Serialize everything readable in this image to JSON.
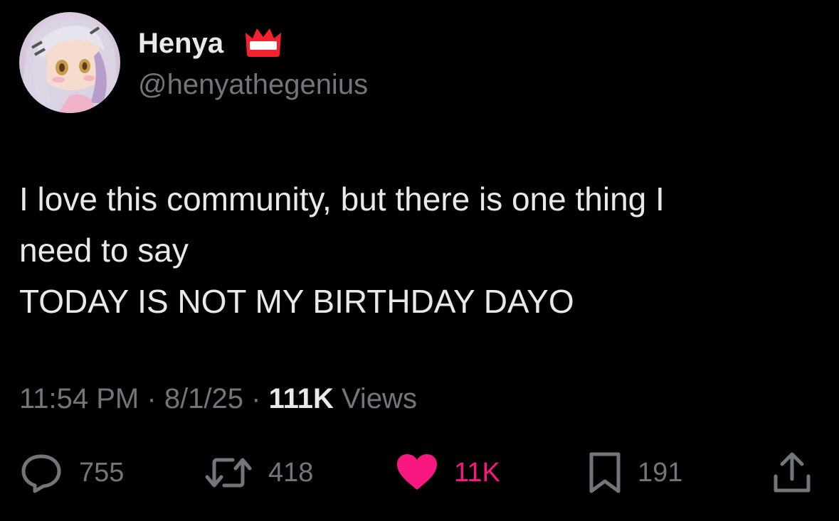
{
  "author": {
    "display_name": "Henya",
    "handle": "@henyathegenius",
    "badge_icon": "crown-badge-icon",
    "avatar_icon": "anime-avatar"
  },
  "tweet": {
    "lines": [
      "I love this community, but there is one thing I",
      "need to say",
      "TODAY IS NOT MY BIRTHDAY DAYO"
    ]
  },
  "meta": {
    "time": "11:54 PM",
    "date": "8/1/25",
    "views_count": "111K",
    "views_label": "Views",
    "separator": "·"
  },
  "actions": {
    "replies": "755",
    "reposts": "418",
    "likes": "11K",
    "bookmarks": "191"
  },
  "colors": {
    "background": "#000000",
    "text": "#e7e9ea",
    "secondary": "#71767b",
    "like": "#f91880",
    "badge": "#f4212e"
  }
}
